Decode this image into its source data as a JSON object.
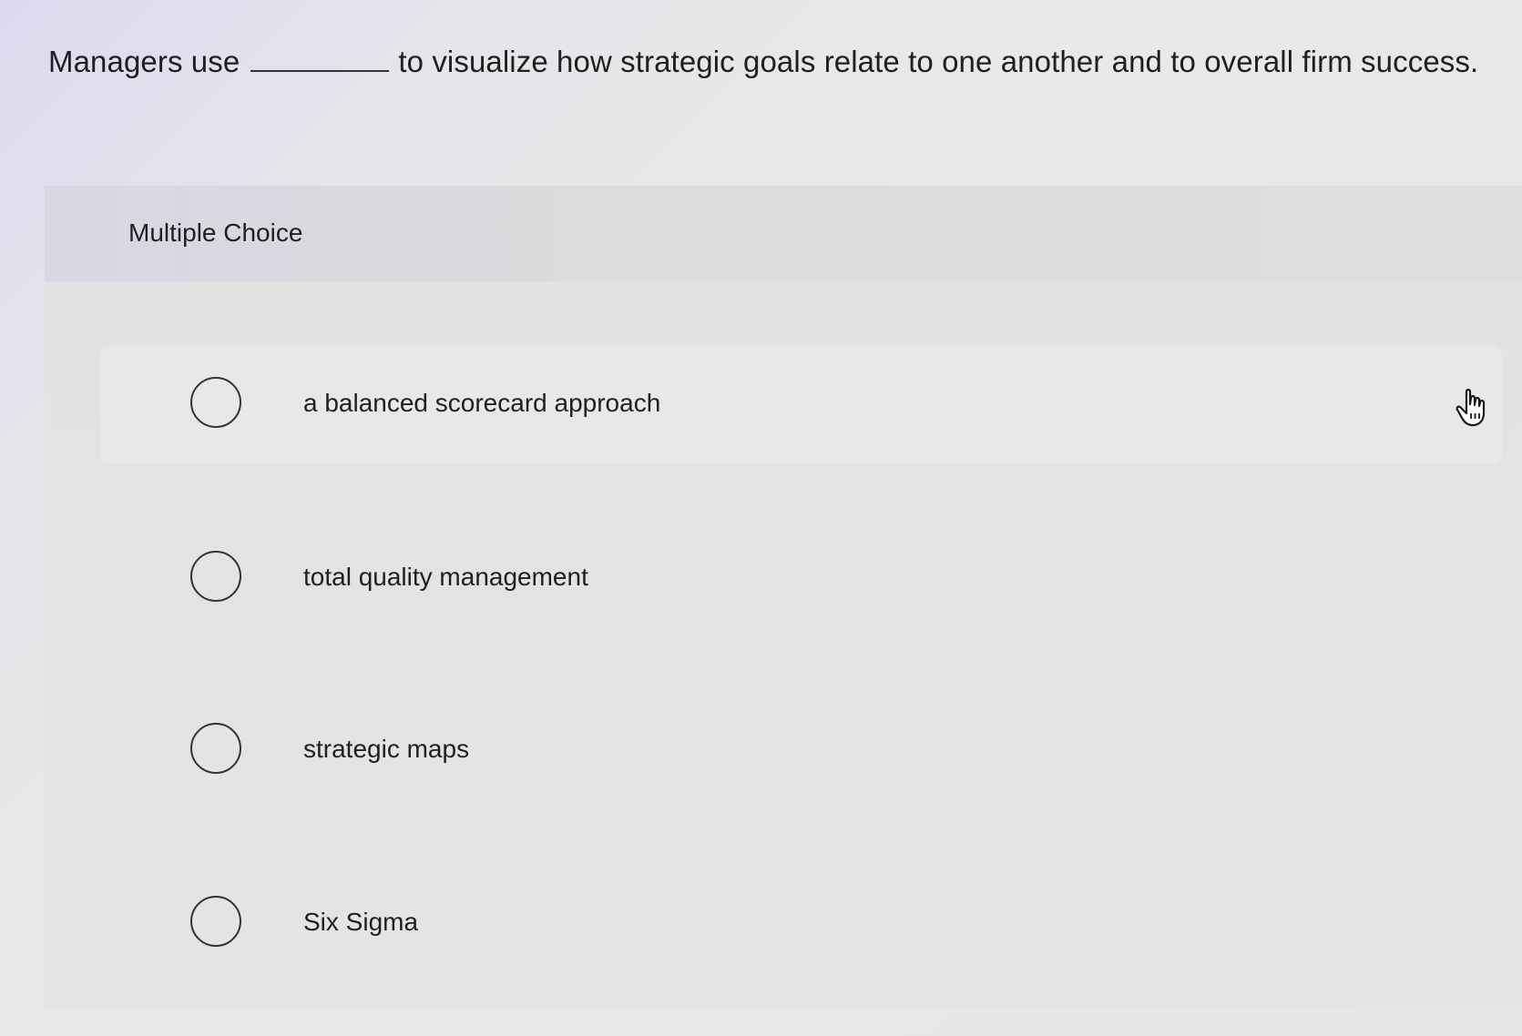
{
  "question": {
    "before_blank": "Managers use",
    "after_blank": "to visualize how strategic goals relate to one another and to overall firm success."
  },
  "panel": {
    "title": "Multiple Choice"
  },
  "options": [
    {
      "label": "a balanced scorecard approach",
      "selected": false
    },
    {
      "label": "total quality management",
      "selected": false
    },
    {
      "label": "strategic maps",
      "selected": false
    },
    {
      "label": "Six Sigma",
      "selected": false
    }
  ],
  "cursor": {
    "icon": "hand-pointer-icon"
  }
}
